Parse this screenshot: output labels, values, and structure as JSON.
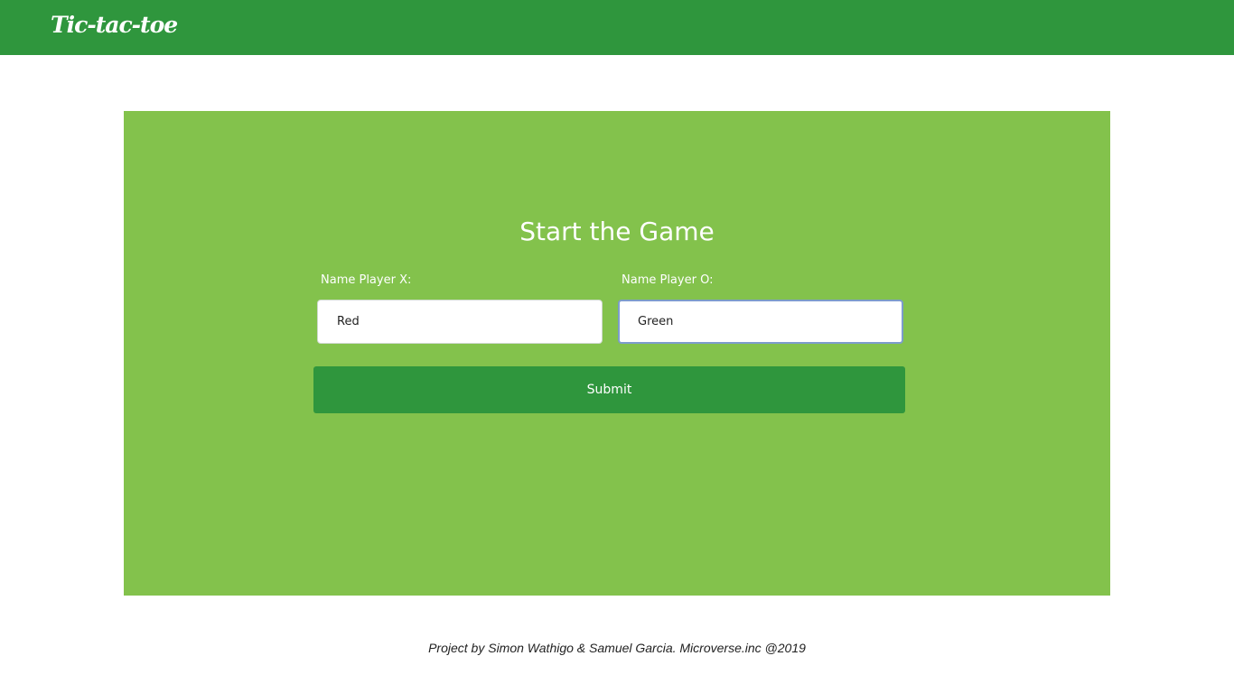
{
  "header": {
    "brand": "Tic-tac-toe"
  },
  "form": {
    "title": "Start the Game",
    "player_x": {
      "label": "Name Player X:",
      "value": "Red"
    },
    "player_o": {
      "label": "Name Player O:",
      "value": "Green"
    },
    "submit_label": "Submit"
  },
  "footer": {
    "credit": "Project by Simon Wathigo & Samuel Garcia. Microverse.inc @2019"
  },
  "colors": {
    "header_bg": "#2f963d",
    "panel_bg": "#83c24c",
    "button_bg": "#2f963d",
    "text_light": "#ffffff"
  }
}
